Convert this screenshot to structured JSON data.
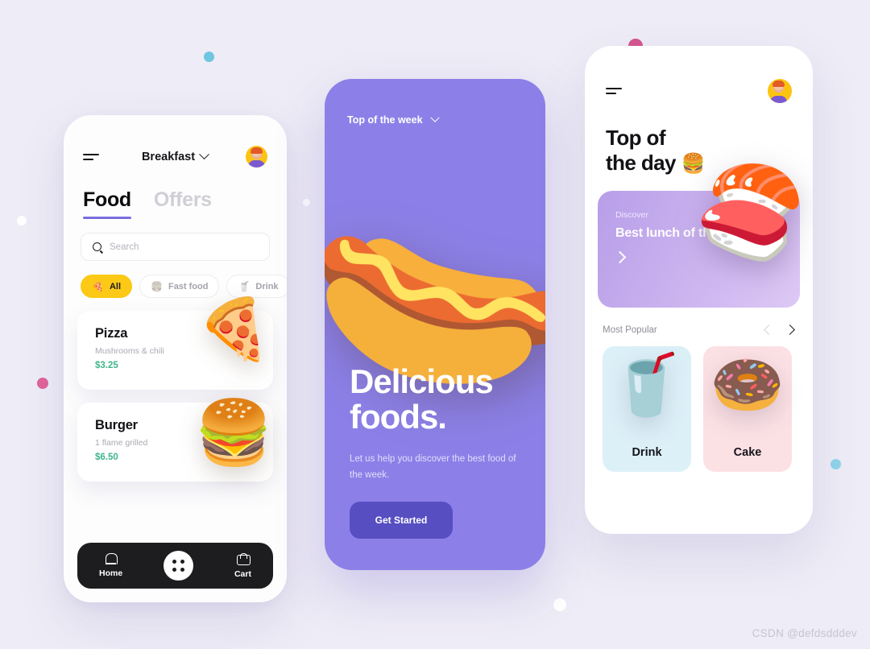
{
  "canvas": {
    "background_color": "#eeecf6",
    "watermark": "CSDN @defdsdddev"
  },
  "phone1": {
    "header": {
      "menu_icon": "hamburger-icon",
      "title": "Breakfast",
      "chevron": "chevron-down-icon",
      "avatar": "user-avatar"
    },
    "tabs": [
      {
        "label": "Food",
        "active": true
      },
      {
        "label": "Offers",
        "active": false
      }
    ],
    "search": {
      "icon": "search-icon",
      "placeholder": "Search",
      "value": ""
    },
    "filters": [
      {
        "label": "All",
        "icon": "🍕",
        "active": true
      },
      {
        "label": "Fast food",
        "icon": "🍔",
        "active": false
      },
      {
        "label": "Drink",
        "icon": "🥤",
        "active": false
      }
    ],
    "foods": [
      {
        "name": "Pizza",
        "desc": "Mushrooms & chili",
        "price": "$3.25",
        "emoji": "🍕"
      },
      {
        "name": "Burger",
        "desc": "1 flame grilled",
        "price": "$6.50",
        "emoji": "🍔"
      }
    ],
    "nav": {
      "home_label": "Home",
      "cart_label": "Cart",
      "center_icon": "grid-dots-icon"
    },
    "colors": {
      "accent_yellow": "#fbc916",
      "accent_purple": "#7b6ce0",
      "price_green": "#3fb58a",
      "nav_bar": "#1d1d1f"
    }
  },
  "phone2": {
    "top_label": "Top of the week",
    "chevron": "chevron-down-icon",
    "hero_emoji": "🌭",
    "headline": "Delicious foods.",
    "subtext": "Let us help you discover the best food of the week.",
    "cta_label": "Get Started",
    "colors": {
      "panel": "#8c80e8",
      "button": "#574ec2"
    }
  },
  "phone3": {
    "header": {
      "menu_icon": "hamburger-icon",
      "avatar": "user-avatar"
    },
    "title_line1": "Top of",
    "title_line2": "the day",
    "title_emoji": "🍔",
    "banner": {
      "kicker": "Discover",
      "title": "Best lunch of the day",
      "arrow": "arrow-right-icon",
      "emoji": "🍣"
    },
    "section": {
      "title": "Most Popular",
      "prev_icon": "chevron-left-icon",
      "next_icon": "arrow-right-icon"
    },
    "popular": [
      {
        "label": "Drink",
        "emoji": "🥤",
        "bg": "#dcf0f8"
      },
      {
        "label": "Cake",
        "emoji": "🍩",
        "bg": "#fbe0e4"
      }
    ]
  },
  "dots": [
    {
      "name": "dot-cyan-top",
      "color": "#6ec6e0"
    },
    {
      "name": "dot-white-left",
      "color": "#ffffff"
    },
    {
      "name": "dot-pink-left",
      "color": "#e0639a"
    },
    {
      "name": "dot-pink-top",
      "color": "#d4558f"
    },
    {
      "name": "dot-cyan-right",
      "color": "#8fd4e8"
    },
    {
      "name": "dot-white-bottom",
      "color": "#ffffff"
    }
  ]
}
